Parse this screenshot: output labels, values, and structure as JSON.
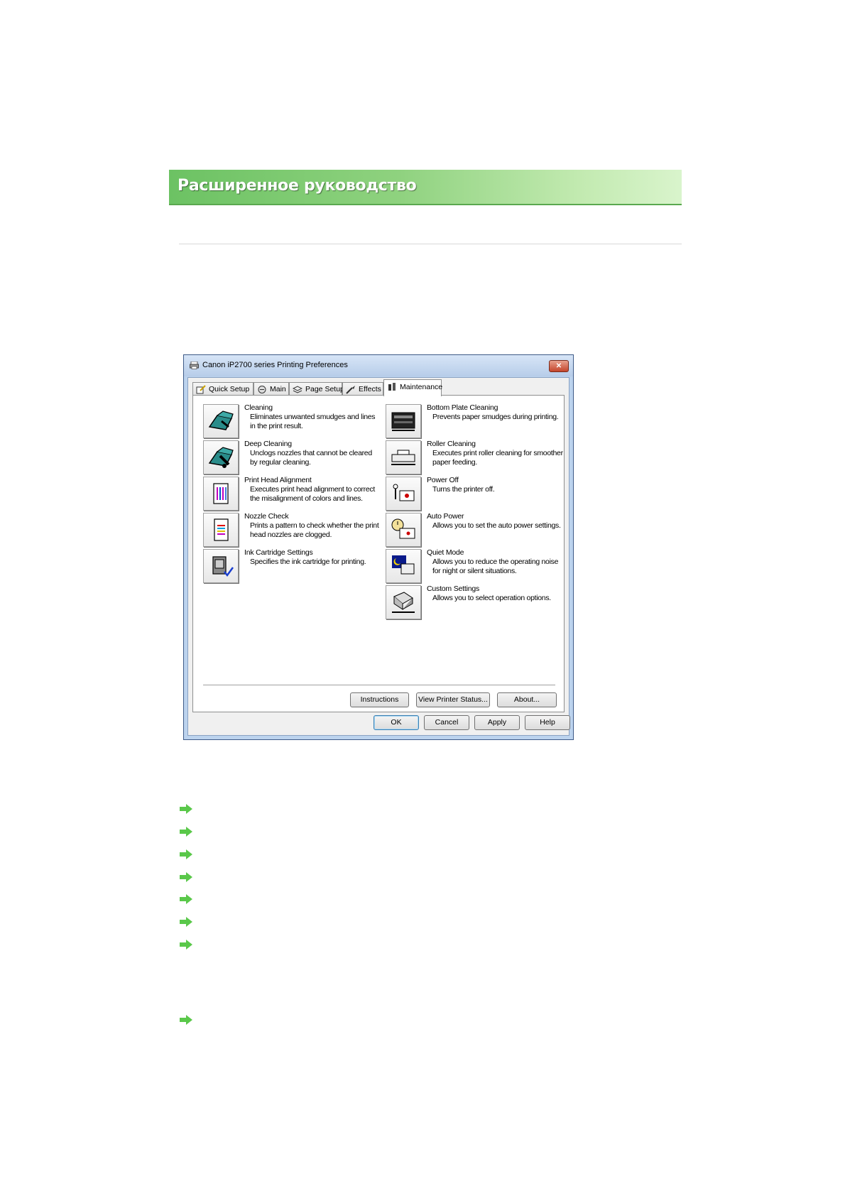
{
  "banner": {
    "title": "Расширенное руководство"
  },
  "dialog": {
    "title": "Canon iP2700 series Printing Preferences",
    "close_label": "✕",
    "tabs": [
      {
        "label": "Quick Setup"
      },
      {
        "label": "Main"
      },
      {
        "label": "Page Setup"
      },
      {
        "label": "Effects"
      },
      {
        "label": "Maintenance"
      }
    ],
    "left_items": [
      {
        "name": "Cleaning",
        "desc": "Eliminates unwanted smudges and lines in the print result.",
        "icon": "cleaning-icon"
      },
      {
        "name": "Deep Cleaning",
        "desc": "Unclogs nozzles that cannot be cleared by regular cleaning.",
        "icon": "deep-cleaning-icon"
      },
      {
        "name": "Print Head Alignment",
        "desc": "Executes print head alignment to correct the misalignment of colors and lines.",
        "icon": "print-head-alignment-icon"
      },
      {
        "name": "Nozzle Check",
        "desc": "Prints a pattern to check whether the print head nozzles are clogged.",
        "icon": "nozzle-check-icon"
      },
      {
        "name": "Ink Cartridge Settings",
        "desc": "Specifies the ink cartridge for printing.",
        "icon": "ink-cartridge-icon"
      }
    ],
    "right_items": [
      {
        "name": "Bottom Plate Cleaning",
        "desc": "Prevents paper smudges during printing.",
        "icon": "bottom-plate-icon"
      },
      {
        "name": "Roller Cleaning",
        "desc": "Executes print roller cleaning for smoother paper feeding.",
        "icon": "roller-cleaning-icon"
      },
      {
        "name": "Power Off",
        "desc": "Turns the printer off.",
        "icon": "power-off-icon"
      },
      {
        "name": "Auto Power",
        "desc": "Allows you to set the auto power settings.",
        "icon": "auto-power-icon"
      },
      {
        "name": "Quiet Mode",
        "desc": "Allows you to reduce the operating noise for night or silent situations.",
        "icon": "quiet-mode-icon"
      },
      {
        "name": "Custom Settings",
        "desc": "Allows you to select operation options.",
        "icon": "custom-settings-icon"
      }
    ],
    "panel_buttons": {
      "instructions": "Instructions",
      "view_status": "View Printer Status...",
      "about": "About..."
    },
    "footer_buttons": {
      "ok": "OK",
      "cancel": "Cancel",
      "apply": "Apply",
      "help": "Help"
    }
  },
  "colors": {
    "banner_green": "#6cc263",
    "arrow_green": "#5ac84a",
    "title_blue": "#bcd3ee"
  }
}
